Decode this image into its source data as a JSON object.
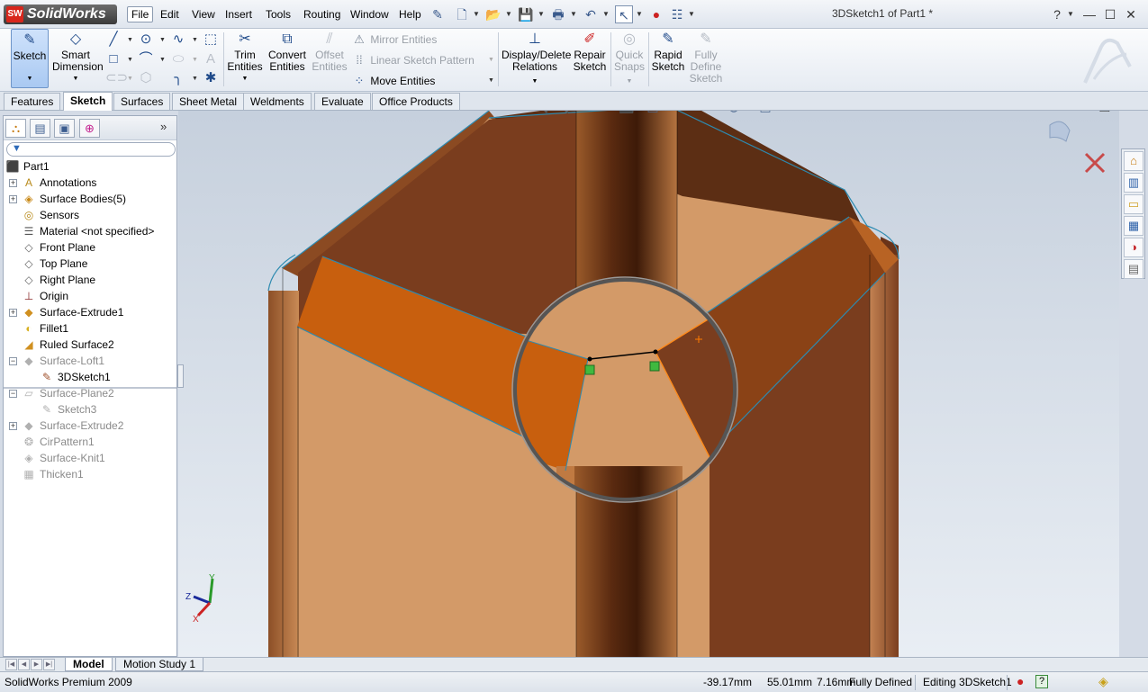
{
  "app": {
    "name": "SolidWorks",
    "badge": "SW",
    "document_title": "3DSketch1 of Part1 *"
  },
  "menu": [
    "File",
    "Edit",
    "View",
    "Insert",
    "Tools",
    "Routing",
    "Window",
    "Help"
  ],
  "window_controls": {
    "help": "?",
    "minimize": "—",
    "maximize": "☐",
    "close": "✕"
  },
  "command_manager": {
    "sketch": "Sketch",
    "smart_dimension": [
      "Smart",
      "Dimension"
    ],
    "trim": [
      "Trim",
      "Entities"
    ],
    "convert": [
      "Convert",
      "Entities"
    ],
    "offset": [
      "Offset",
      "Entities"
    ],
    "mirror": "Mirror Entities",
    "linear_pattern": "Linear Sketch Pattern",
    "move": "Move Entities",
    "display_delete": [
      "Display/Delete",
      "Relations"
    ],
    "repair": [
      "Repair",
      "Sketch"
    ],
    "quick_snaps": [
      "Quick",
      "Snaps"
    ],
    "rapid_sketch": [
      "Rapid",
      "Sketch"
    ],
    "fully_define": [
      "Fully",
      "Define",
      "Sketch"
    ]
  },
  "tabs": [
    "Features",
    "Sketch",
    "Surfaces",
    "Sheet Metal",
    "Weldments",
    "Evaluate",
    "Office Products"
  ],
  "active_tab": "Sketch",
  "feature_tree": [
    {
      "label": "Part1",
      "icon": "part-icon",
      "suppressed": false,
      "expand": ""
    },
    {
      "label": "Annotations",
      "icon": "annotations-icon",
      "suppressed": false,
      "expand": "+"
    },
    {
      "label": "Surface Bodies(5)",
      "icon": "surface-bodies-icon",
      "suppressed": false,
      "expand": "+"
    },
    {
      "label": "Sensors",
      "icon": "sensors-icon",
      "suppressed": false,
      "expand": ""
    },
    {
      "label": "Material <not specified>",
      "icon": "material-icon",
      "suppressed": false,
      "expand": ""
    },
    {
      "label": "Front Plane",
      "icon": "plane-icon",
      "suppressed": false,
      "expand": ""
    },
    {
      "label": "Top Plane",
      "icon": "plane-icon",
      "suppressed": false,
      "expand": ""
    },
    {
      "label": "Right Plane",
      "icon": "plane-icon",
      "suppressed": false,
      "expand": ""
    },
    {
      "label": "Origin",
      "icon": "origin-icon",
      "suppressed": false,
      "expand": ""
    },
    {
      "label": "Surface-Extrude1",
      "icon": "surface-extrude-icon",
      "suppressed": false,
      "expand": "+"
    },
    {
      "label": "Fillet1",
      "icon": "fillet-icon",
      "suppressed": false,
      "expand": ""
    },
    {
      "label": "Ruled Surface2",
      "icon": "ruled-surface-icon",
      "suppressed": false,
      "expand": ""
    },
    {
      "label": "Surface-Loft1",
      "icon": "surface-loft-icon",
      "suppressed": true,
      "expand": "−"
    },
    {
      "label": "3DSketch1",
      "icon": "3d-sketch-icon",
      "suppressed": false,
      "expand": ""
    },
    {
      "label": "Surface-Plane2",
      "icon": "surface-plane-icon",
      "suppressed": true,
      "expand": "−"
    },
    {
      "label": "Sketch3",
      "icon": "sketch-icon",
      "suppressed": true,
      "expand": ""
    },
    {
      "label": "Surface-Extrude2",
      "icon": "surface-extrude-icon",
      "suppressed": true,
      "expand": "+"
    },
    {
      "label": "CirPattern1",
      "icon": "circular-pattern-icon",
      "suppressed": true,
      "expand": ""
    },
    {
      "label": "Surface-Knit1",
      "icon": "surface-knit-icon",
      "suppressed": true,
      "expand": ""
    },
    {
      "label": "Thicken1",
      "icon": "thicken-icon",
      "suppressed": true,
      "expand": ""
    }
  ],
  "triad": {
    "x": "X",
    "y": "Y",
    "z": "Z"
  },
  "bottom_tabs": [
    "Model",
    "Motion Study 1"
  ],
  "status": {
    "product": "SolidWorks Premium 2009",
    "x": "-39.17mm",
    "y": "55.01mm",
    "z": "7.16mm",
    "state": "Fully Defined",
    "editing": "Editing 3DSketch1",
    "help": "?"
  },
  "colors": {
    "face_light": "#d39a68",
    "face_dark": "#7a3d1e",
    "face_orange": "#c85f0e",
    "edge": "#2d8ab0",
    "accent": "#1f4a8a"
  }
}
